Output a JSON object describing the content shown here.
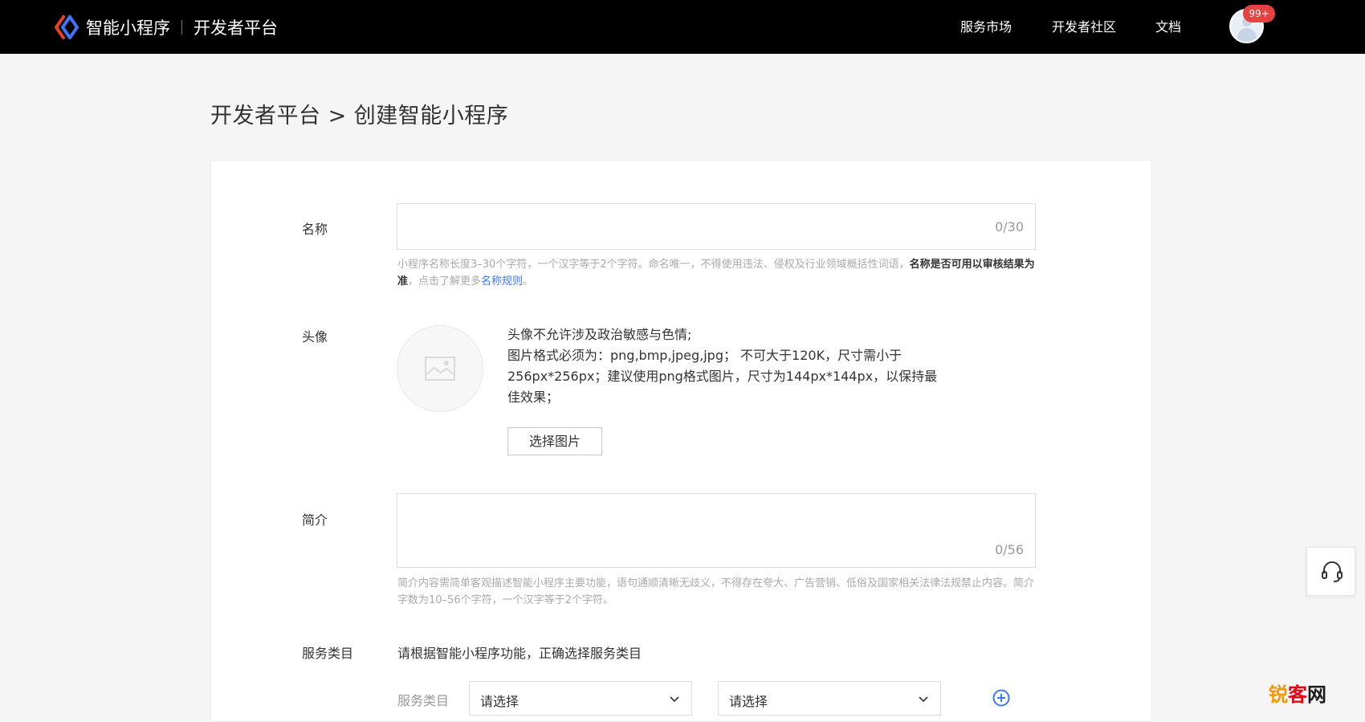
{
  "header": {
    "brand_name": "智能小程序",
    "brand_sub": "开发者平台",
    "nav": [
      "服务市场",
      "开发者社区",
      "文档"
    ],
    "notification_badge": "99+"
  },
  "page_title": "开发者平台 > 创建智能小程序",
  "form": {
    "name": {
      "label": "名称",
      "value": "",
      "counter": "0/30",
      "hint_prefix": "小程序名称长度3–30个字符，一个汉字等于2个字符。命名唯一，不得使用违法、侵权及行业领域概括性词语，",
      "hint_bold": "名称是否可用以审核结果为准",
      "hint_mid": "，点击了解更多",
      "hint_link": "名称规则",
      "hint_end": "。"
    },
    "avatar": {
      "label": "头像",
      "rules": [
        "头像不允许涉及政治敏感与色情;",
        "图片格式必须为：png,bmp,jpeg,jpg；  不可大于120K，尺寸需小于256px*256px；建议使用png格式图片，尺寸为144px*144px，以保持最佳效果；"
      ],
      "button_label": "选择图片"
    },
    "intro": {
      "label": "简介",
      "value": "",
      "counter": "0/56",
      "hint": "简介内容需简单客观描述智能小程序主要功能，语句通顺清晰无歧义，不得存在夸大、广告营销、低俗及国家相关法律法规禁止内容。简介字数为10–56个字符，一个汉字等于2个字符。"
    },
    "service_category": {
      "label": "服务类目",
      "tip": "请根据智能小程序功能，正确选择服务类目",
      "sub_label": "服务类目",
      "select_1": "请选择",
      "select_2": "请选择"
    }
  },
  "watermark": {
    "part1": "锐",
    "part2": "客",
    "part3": "网"
  },
  "colors": {
    "topbar": "#000000",
    "link": "#3c76ff",
    "badge": "#e64340",
    "accent_add": "#3c76ff"
  }
}
